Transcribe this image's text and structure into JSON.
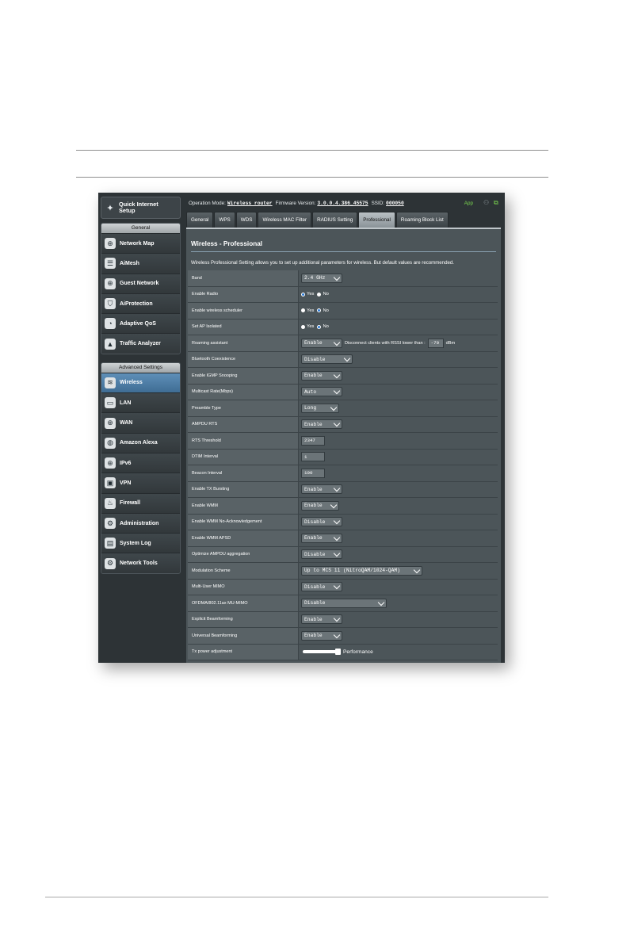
{
  "header": {
    "operation_mode_label": "Operation Mode:",
    "operation_mode_value": "Wireless router",
    "firmware_label": "Firmware Version:",
    "firmware_value": "3.0.0.4.386_45575",
    "ssid_label": "SSID:",
    "ssid_value": "000050",
    "app_label": "App"
  },
  "sidebar": {
    "quick_setup": "Quick Internet\nSetup",
    "general_title": "General",
    "general_items": [
      {
        "label": "Network Map",
        "icon": "network-map-icon"
      },
      {
        "label": "AiMesh",
        "icon": "aimesh-icon"
      },
      {
        "label": "Guest Network",
        "icon": "guest-network-icon"
      },
      {
        "label": "AiProtection",
        "icon": "shield-icon"
      },
      {
        "label": "Adaptive QoS",
        "icon": "gauge-icon"
      },
      {
        "label": "Traffic Analyzer",
        "icon": "analyzer-icon"
      }
    ],
    "advanced_title": "Advanced Settings",
    "advanced_items": [
      {
        "label": "Wireless",
        "icon": "wifi-icon",
        "active": true
      },
      {
        "label": "LAN",
        "icon": "monitor-icon"
      },
      {
        "label": "WAN",
        "icon": "globe-icon"
      },
      {
        "label": "Amazon Alexa",
        "icon": "alexa-icon"
      },
      {
        "label": "IPv6",
        "icon": "ipv6-icon"
      },
      {
        "label": "VPN",
        "icon": "vpn-icon"
      },
      {
        "label": "Firewall",
        "icon": "fire-icon"
      },
      {
        "label": "Administration",
        "icon": "admin-icon"
      },
      {
        "label": "System Log",
        "icon": "log-icon"
      },
      {
        "label": "Network Tools",
        "icon": "tools-icon"
      }
    ]
  },
  "tabs": [
    "General",
    "WPS",
    "WDS",
    "Wireless MAC Filter",
    "RADIUS Setting",
    "Professional",
    "Roaming Block List"
  ],
  "active_tab": "Professional",
  "page": {
    "title": "Wireless - Professional",
    "description": "Wireless Professional Setting allows you to set up additional parameters for wireless. But default values are recommended."
  },
  "settings": [
    {
      "label": "Band",
      "type": "select",
      "value": "2.4 GHz",
      "width": 1
    },
    {
      "label": "Enable Radio",
      "type": "radio",
      "options": [
        "Yes",
        "No"
      ],
      "selected": "Yes"
    },
    {
      "label": "Enable wireless scheduler",
      "type": "radio",
      "options": [
        "Yes",
        "No"
      ],
      "selected": "No"
    },
    {
      "label": "Set AP Isolated",
      "type": "radio",
      "options": [
        "Yes",
        "No"
      ],
      "selected": "No"
    },
    {
      "label": "Roaming assistant",
      "type": "roaming",
      "value": "Enable",
      "note": "Disconnect clients with RSSI lower than :",
      "rssi": "-70",
      "unit": "dBm"
    },
    {
      "label": "Bluetooth Coexistence",
      "type": "select",
      "value": "Disable",
      "width": 2
    },
    {
      "label": "Enable IGMP Snooping",
      "type": "select",
      "value": "Enable",
      "width": 1
    },
    {
      "label": "Multicast Rate(Mbps)",
      "type": "select",
      "value": "Auto",
      "width": 1
    },
    {
      "label": "Preamble Type",
      "type": "select",
      "value": "Long",
      "width": 0
    },
    {
      "label": "AMPDU RTS",
      "type": "select",
      "value": "Enable",
      "width": 1
    },
    {
      "label": "RTS Threshold",
      "type": "text",
      "value": "2347"
    },
    {
      "label": "DTIM Interval",
      "type": "text",
      "value": "1"
    },
    {
      "label": "Beacon Interval",
      "type": "text",
      "value": "100"
    },
    {
      "label": "Enable TX Bursting",
      "type": "select",
      "value": "Enable",
      "width": 1
    },
    {
      "label": "Enable WMM",
      "type": "select",
      "value": "Enable",
      "width": 0
    },
    {
      "label": "Enable WMM No-Acknowledgement",
      "type": "select",
      "value": "Disable",
      "width": 1
    },
    {
      "label": "Enable WMM APSD",
      "type": "select",
      "value": "Enable",
      "width": 1
    },
    {
      "label": "Optimize AMPDU aggregation",
      "type": "select",
      "value": "Disable",
      "width": 1
    },
    {
      "label": "Modulation Scheme",
      "type": "select",
      "value": "Up to MCS 11 (NitroQAM/1024-QAM)",
      "width": 4
    },
    {
      "label": "Multi-User MIMO",
      "type": "select",
      "value": "Disable",
      "width": 1
    },
    {
      "label": "OFDMA/802.11ax MU-MIMO",
      "type": "select",
      "value": "Disable",
      "width": 3
    },
    {
      "label": "Explicit Beamforming",
      "type": "select",
      "value": "Enable",
      "width": 1
    },
    {
      "label": "Universal Beamforming",
      "type": "select",
      "value": "Enable",
      "width": 1
    },
    {
      "label": "Tx power adjustment",
      "type": "slider",
      "value": "Performance",
      "level": 1.0
    }
  ]
}
